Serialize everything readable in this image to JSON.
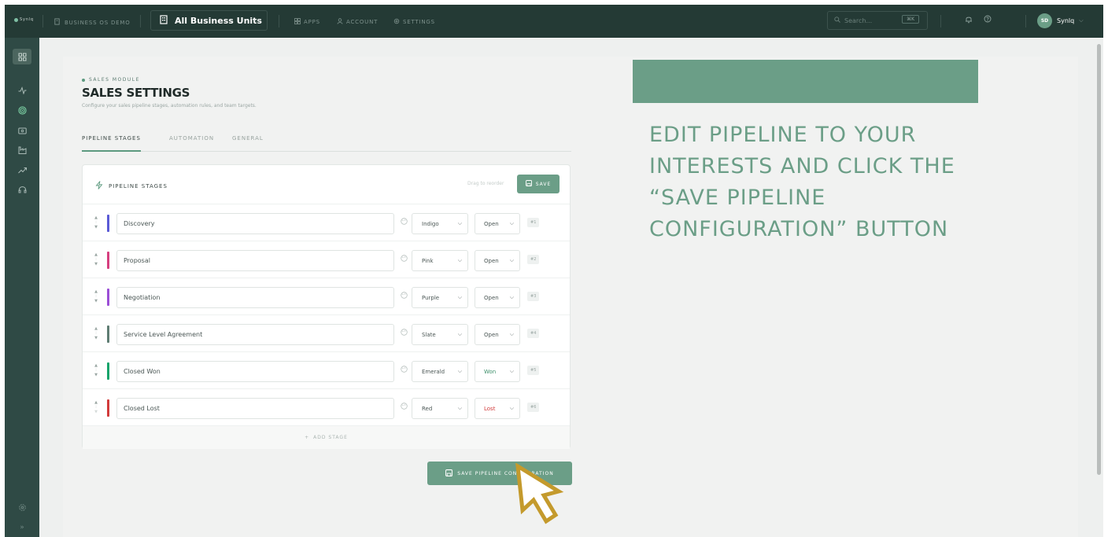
{
  "topbar": {
    "brand": "Synlq",
    "workspace": "BUSINESS OS DEMO",
    "business_unit": "All Business Units",
    "nav": [
      {
        "label": "APPS",
        "icon": "grid-icon"
      },
      {
        "label": "ACCOUNT",
        "icon": "user-icon"
      },
      {
        "label": "SETTINGS",
        "icon": "gear-icon"
      }
    ],
    "search_placeholder": "Search...",
    "search_shortcut": "⌘K",
    "user_initials": "SD",
    "user_name": "Synlq"
  },
  "rail": {
    "items": [
      "dashboard-icon",
      "activity-icon",
      "target-icon",
      "money-icon",
      "factory-icon",
      "trend-icon",
      "headset-icon"
    ],
    "footer": [
      "settings-icon",
      "expand-icon"
    ]
  },
  "page": {
    "module": "SALES MODULE",
    "title": "SALES SETTINGS",
    "subtitle": "Configure your sales pipeline stages, automation rules, and team targets.",
    "tabs": [
      "PIPELINE STAGES",
      "AUTOMATION",
      "GENERAL"
    ],
    "active_tab": "PIPELINE STAGES"
  },
  "pipeline": {
    "heading": "PIPELINE STAGES",
    "drag_hint": "Drag to reorder",
    "save_label": "SAVE",
    "add_stage_label": "ADD STAGE",
    "save_config_label": "SAVE PIPELINE CONFIGURATION",
    "stages": [
      {
        "name": "Discovery",
        "color": "Indigo",
        "color_hex": "#5b5bd6",
        "status": "Open",
        "status_hex": "#4a5654",
        "order": "#1"
      },
      {
        "name": "Proposal",
        "color": "Pink",
        "color_hex": "#d6407f",
        "status": "Open",
        "status_hex": "#4a5654",
        "order": "#2"
      },
      {
        "name": "Negotiation",
        "color": "Purple",
        "color_hex": "#9b4fd6",
        "status": "Open",
        "status_hex": "#4a5654",
        "order": "#3"
      },
      {
        "name": "Service Level Agreement",
        "color": "Slate",
        "color_hex": "#5f7d73",
        "status": "Open",
        "status_hex": "#4a5654",
        "order": "#4"
      },
      {
        "name": "Closed Won",
        "color": "Emerald",
        "color_hex": "#17a46b",
        "status": "Won",
        "status_hex": "#3d8f6a",
        "order": "#5"
      },
      {
        "name": "Closed Lost",
        "color": "Red",
        "color_hex": "#d23b3b",
        "status": "Lost",
        "status_hex": "#d23b3b",
        "order": "#6"
      }
    ]
  },
  "overlay": {
    "instruction": "EDIT PIPELINE TO YOUR INTERESTS AND CLICK THE “SAVE PIPELINE CONFIGURATION” BUTTON",
    "accent": "#6b9e87",
    "cursor_color": "#c49a2c"
  }
}
